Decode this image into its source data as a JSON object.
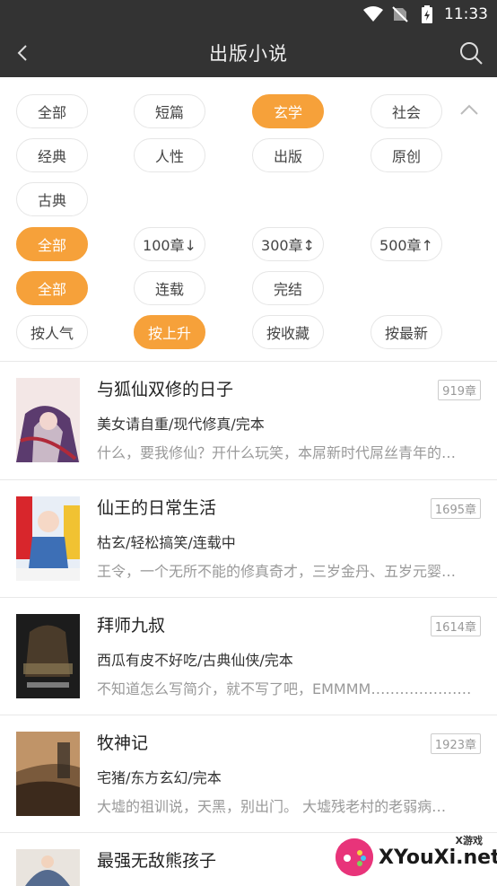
{
  "status": {
    "time": "11:33"
  },
  "header": {
    "title": "出版小说"
  },
  "filters": {
    "categories": [
      "全部",
      "短篇",
      "玄学",
      "社会",
      "经典",
      "人性",
      "出版",
      "原创",
      "古典"
    ],
    "category_selected": "玄学",
    "chapters": [
      "全部",
      "100章↓",
      "300章↕",
      "500章↑"
    ],
    "chapters_selected": "全部",
    "status": [
      "全部",
      "连载",
      "完结"
    ],
    "status_selected": "全部",
    "sort": [
      "按人气",
      "按上升",
      "按收藏",
      "按最新"
    ],
    "sort_selected": "按上升"
  },
  "books": [
    {
      "title": "与狐仙双修的日子",
      "chapters": "919章",
      "meta": "美女请自重/现代修真/完本",
      "desc": "什么，要我修仙？开什么玩笑，本屌新时代屌丝青年的…",
      "cover_text": "与狐仙双修的日子"
    },
    {
      "title": "仙王的日常生活",
      "chapters": "1695章",
      "meta": "枯玄/轻松搞笑/连载中",
      "desc": "王令，一个无所不能的修真奇才，三岁金丹、五岁元婴…",
      "cover_text": "仙王的日常生活"
    },
    {
      "title": "拜师九叔",
      "chapters": "1614章",
      "meta": "西瓜有皮不好吃/古典仙侠/完本",
      "desc": "不知道怎么写简介，就不写了吧，EMMMM……………………",
      "cover_text": "拜师九叔"
    },
    {
      "title": "牧神记",
      "chapters": "1923章",
      "meta": "宅猪/东方玄幻/完本",
      "desc": "大墟的祖训说，天黑，别出门。 大墟残老村的老弱病…",
      "cover_text": "牧神记"
    },
    {
      "title": "最强无敌熊孩子",
      "chapters": "",
      "meta": "",
      "desc": "",
      "cover_text": ""
    }
  ],
  "watermark": {
    "text": "XYouXi.net",
    "small": "X游戏"
  },
  "colors": {
    "accent": "#f6a13a",
    "bar": "#333333"
  }
}
